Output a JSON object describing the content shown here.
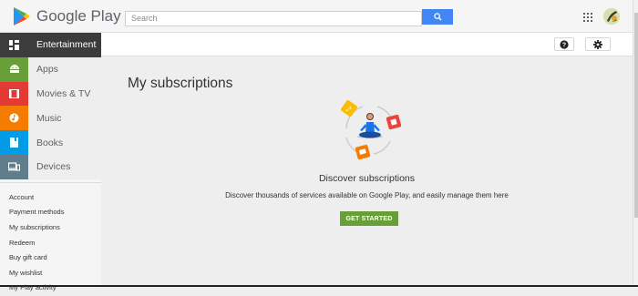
{
  "header": {
    "brand": "Google Play",
    "search_placeholder": "Search"
  },
  "sidebar": {
    "categories": [
      {
        "label": "Entertainment",
        "color": "#3c3c3c",
        "icon": "entertainment-icon",
        "active": true
      },
      {
        "label": "Apps",
        "color": "#689f38",
        "icon": "android-icon"
      },
      {
        "label": "Movies & TV",
        "color": "#e53935",
        "icon": "film-icon"
      },
      {
        "label": "Music",
        "color": "#f57c00",
        "icon": "music-icon"
      },
      {
        "label": "Books",
        "color": "#039be5",
        "icon": "book-icon"
      },
      {
        "label": "Devices",
        "color": "#607d8b",
        "icon": "devices-icon"
      }
    ],
    "account_links": [
      "Account",
      "Payment methods",
      "My subscriptions",
      "Redeem",
      "Buy gift card",
      "My wishlist",
      "My Play activity"
    ]
  },
  "main": {
    "title": "My subscriptions",
    "discover_title": "Discover subscriptions",
    "discover_text": "Discover thousands of services available on Google Play, and easily manage them here",
    "cta_label": "GET STARTED"
  },
  "colors": {
    "accent_blue": "#4285f4",
    "cta_green": "#689f38"
  }
}
